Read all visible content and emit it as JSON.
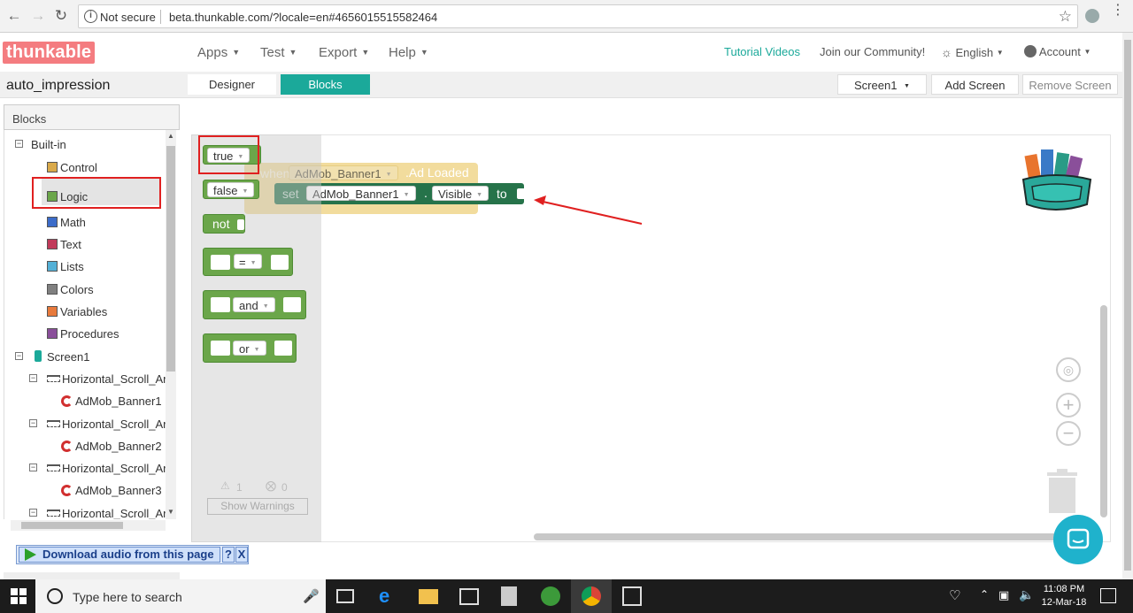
{
  "browser": {
    "security_label": "Not secure",
    "url": "beta.thunkable.com/?locale=en#4656015515582464"
  },
  "header": {
    "logo_text": "thunkable",
    "menus": [
      "Apps",
      "Test",
      "Export",
      "Help"
    ],
    "tutorial_link": "Tutorial Videos",
    "community_link": "Join our Community!",
    "language": "English",
    "account": "Account"
  },
  "project": {
    "name": "auto_impression",
    "designer_label": "Designer",
    "blocks_label": "Blocks",
    "screen_select": "Screen1",
    "add_screen": "Add Screen",
    "remove_screen": "Remove Screen"
  },
  "palette": {
    "heading": "Blocks",
    "builtin_label": "Built-in",
    "builtin": [
      {
        "label": "Control",
        "color": "#d9a94a"
      },
      {
        "label": "Logic",
        "color": "#6ba64a"
      },
      {
        "label": "Math",
        "color": "#3c6cc9"
      },
      {
        "label": "Text",
        "color": "#c13a5a"
      },
      {
        "label": "Lists",
        "color": "#54b0d6"
      },
      {
        "label": "Colors",
        "color": "#808080"
      },
      {
        "label": "Variables",
        "color": "#e87a3c"
      },
      {
        "label": "Procedures",
        "color": "#8a4f9a"
      }
    ],
    "screen_label": "Screen1",
    "components": [
      {
        "label": "Horizontal_Scroll_Arr",
        "type": "arrangement"
      },
      {
        "label": "AdMob_Banner1",
        "type": "admob"
      },
      {
        "label": "Horizontal_Scroll_Arr",
        "type": "arrangement"
      },
      {
        "label": "AdMob_Banner2",
        "type": "admob"
      },
      {
        "label": "Horizontal_Scroll_Arr",
        "type": "arrangement"
      },
      {
        "label": "AdMob_Banner3",
        "type": "admob"
      },
      {
        "label": "Horizontal_Scroll_Arr",
        "type": "arrangement"
      }
    ]
  },
  "flyout": {
    "true_label": "true",
    "false_label": "false",
    "not_label": "not",
    "eq_label": "=",
    "and_label": "and",
    "or_label": "or"
  },
  "workspace": {
    "event_when": "when",
    "event_component": "AdMob_Banner1",
    "event_name": ".Ad Loaded",
    "set_label": "set",
    "set_component": "AdMob_Banner1",
    "set_dot": ".",
    "set_property": "Visible",
    "set_to": "to"
  },
  "warnings": {
    "warning_count": "1",
    "error_count": "0",
    "show_warnings": "Show Warnings"
  },
  "audio_bar": {
    "label": "Download audio from this page",
    "help": "?",
    "close": "X"
  },
  "taskbar": {
    "search_placeholder": "Type here to search",
    "time": "11:08 PM",
    "date": "12-Mar-18"
  }
}
